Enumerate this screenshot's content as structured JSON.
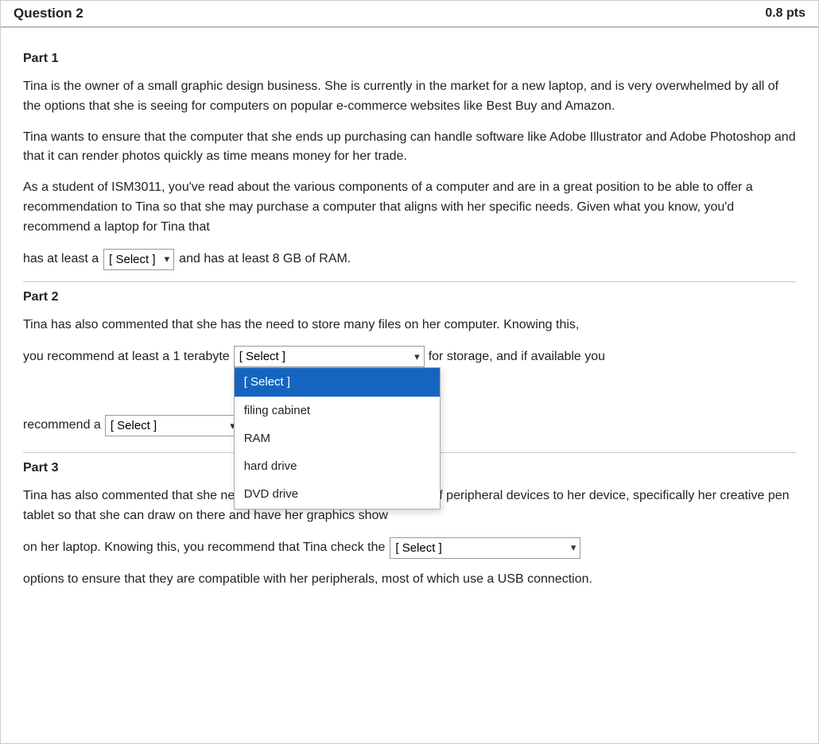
{
  "header": {
    "title": "Question 2",
    "pts": "0.8 pts"
  },
  "part1": {
    "label": "Part 1",
    "paragraphs": [
      "Tina is the owner of a small graphic design business. She is currently in the market for a new laptop, and is very overwhelmed by all of the options that she is seeing for computers on popular e-commerce websites like Best Buy and Amazon.",
      "Tina wants to ensure that the computer that she ends up purchasing can handle software like Adobe Illustrator and Adobe Photoshop and that it can render photos quickly as time means money for her trade.",
      "As a student of ISM3011, you've read about the various components of a computer and are in a great position to be able to offer a recommendation to Tina so that she may purchase a computer that aligns with her specific needs. Given what you know, you'd recommend a laptop for Tina that"
    ],
    "inline_prefix": "has at least a",
    "select1_placeholder": "[ Select ]",
    "inline_suffix": "and has at least 8 GB of RAM."
  },
  "part2": {
    "label": "Part 2",
    "paragraph": "Tina has also commented that she has the need to store many files on her computer. Knowing this,",
    "row1_prefix": "you recommend at least a 1 terabyte",
    "select2_placeholder": "[ Select ]",
    "row1_suffix": "for storage, and if available you",
    "row2_prefix": "recommend a",
    "select3_placeholder": "[ Select ]",
    "dropdown_items": [
      {
        "label": "[ Select ]",
        "highlighted": true
      },
      {
        "label": "filing cabinet",
        "highlighted": false
      },
      {
        "label": "RAM",
        "highlighted": false
      },
      {
        "label": "hard drive",
        "highlighted": false
      },
      {
        "label": "DVD drive",
        "highlighted": false
      }
    ]
  },
  "part3": {
    "label": "Part 3",
    "paragraph1": "Tina has also commented that she needs to be able to connect a variety of peripheral devices to her device, specifically her creative pen tablet so that she can draw on there and have her graphics show",
    "inline_prefix": "on her laptop. Knowing this, you recommend that Tina check the",
    "select4_placeholder": "[ Select ]",
    "paragraph2": "options to ensure that they are compatible with her peripherals, most of which use a USB connection."
  }
}
